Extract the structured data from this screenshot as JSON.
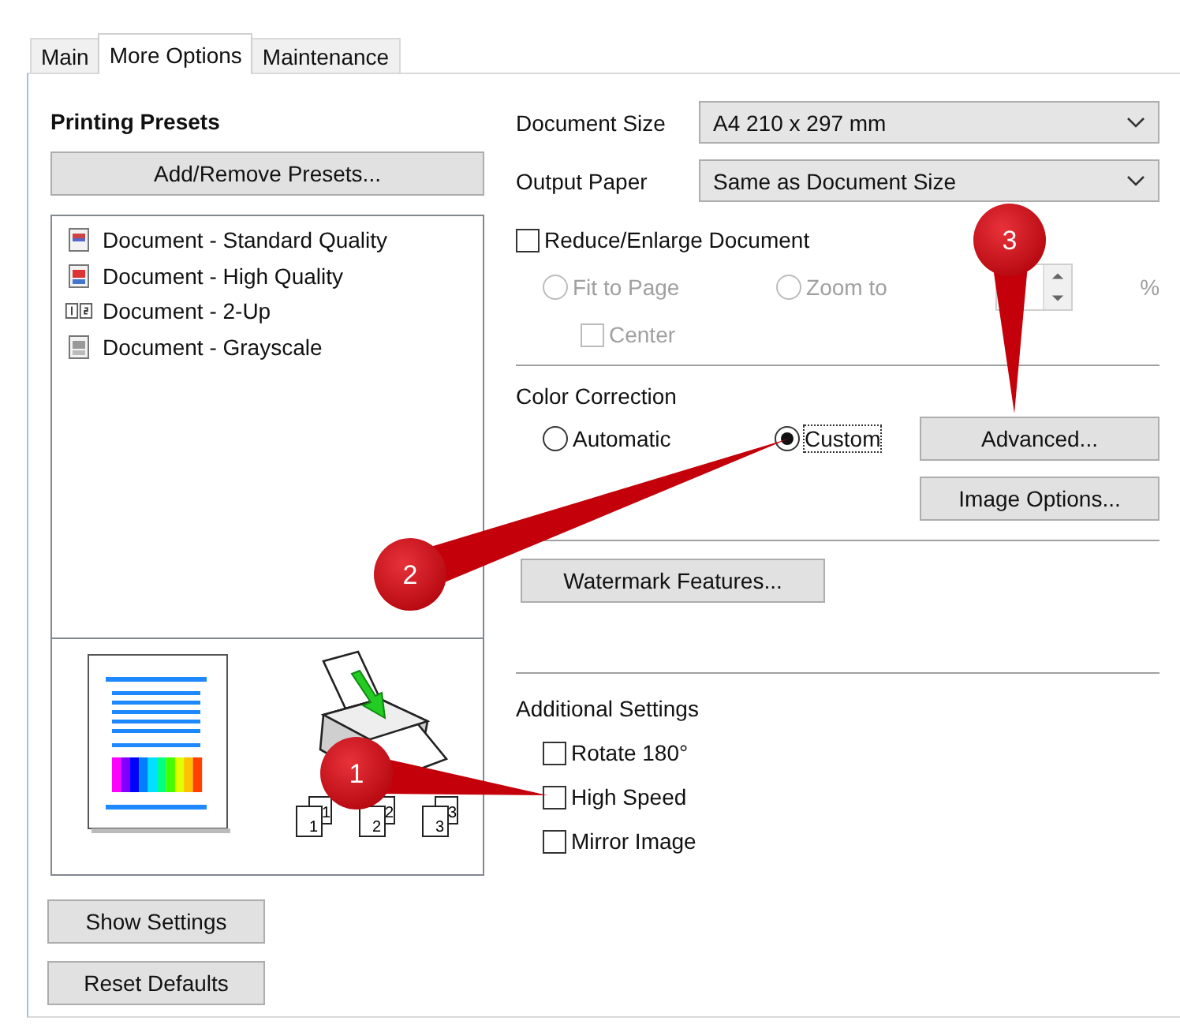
{
  "tabs": [
    {
      "label": "Main",
      "selected": false
    },
    {
      "label": "More Options",
      "selected": true
    },
    {
      "label": "Maintenance",
      "selected": false
    }
  ],
  "presets": {
    "title": "Printing Presets",
    "add_button": "Add/Remove Presets...",
    "items": [
      {
        "label": "Document - Standard Quality",
        "kind": "standard"
      },
      {
        "label": "Document - High Quality",
        "kind": "high"
      },
      {
        "label": "Document - 2-Up",
        "kind": "twoup"
      },
      {
        "label": "Document - Grayscale",
        "kind": "grayscale"
      }
    ]
  },
  "preview": {
    "collate_pages": [
      {
        "back": "1",
        "front": "1"
      },
      {
        "back": "2",
        "front": "2"
      },
      {
        "back": "3",
        "front": "3"
      }
    ]
  },
  "show_settings": "Show Settings",
  "reset_defaults": "Reset Defaults",
  "document_size": {
    "label": "Document Size",
    "value": "A4 210 x 297 mm"
  },
  "output_paper": {
    "label": "Output Paper",
    "value": "Same as Document Size"
  },
  "reduce_enlarge": {
    "label": "Reduce/Enlarge Document",
    "checked": false,
    "fit_to_page": {
      "label": "Fit to Page",
      "selected": false,
      "disabled": true
    },
    "zoom_to": {
      "label": "Zoom to",
      "selected": false,
      "disabled": true
    },
    "percent_unit": "%",
    "center": {
      "label": "Center",
      "checked": false,
      "disabled": true
    }
  },
  "color_correction": {
    "title": "Color Correction",
    "options": [
      {
        "label": "Automatic",
        "selected": false
      },
      {
        "label": "Custom",
        "selected": true
      }
    ]
  },
  "advanced_button": "Advanced...",
  "image_options_button": "Image Options...",
  "watermark_button": "Watermark Features...",
  "additional_settings": {
    "title": "Additional Settings",
    "options": [
      {
        "label": "Rotate 180°",
        "checked": false
      },
      {
        "label": "High Speed",
        "checked": false
      },
      {
        "label": "Mirror Image",
        "checked": false
      }
    ]
  },
  "callouts": [
    {
      "number": "1"
    },
    {
      "number": "2"
    },
    {
      "number": "3"
    }
  ]
}
